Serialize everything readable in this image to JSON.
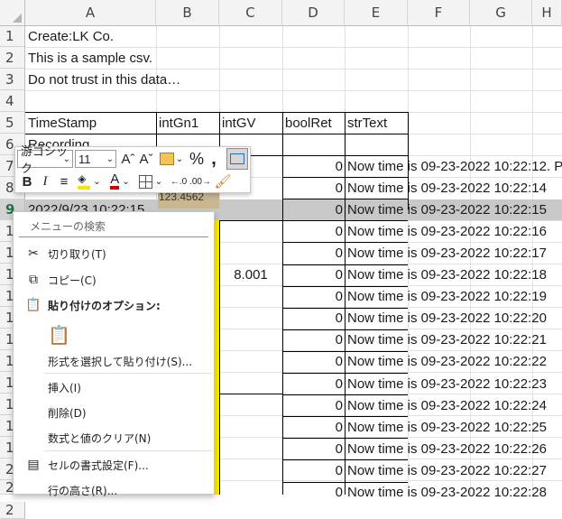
{
  "columns": [
    "A",
    "B",
    "C",
    "D",
    "E",
    "F",
    "G",
    "H"
  ],
  "rows": [
    "1",
    "2",
    "3",
    "4",
    "5",
    "6",
    "7",
    "8",
    "9",
    "1",
    "1",
    "1",
    "1",
    "1",
    "1",
    "1",
    "1",
    "1",
    "1",
    "1",
    "2",
    "2",
    "2"
  ],
  "cells": {
    "a1": "Create:LK Co.",
    "a2": "This is a sample csv.",
    "a3": "Do not trust in this data…",
    "a5": "TimeStamp",
    "b5": "intGn1",
    "c5": "intGV",
    "d5": "boolRet",
    "e5": "strText",
    "a6": "Recording",
    "b8": "123.4562",
    "a9": "2022/9/23 10:22:15",
    "c_merged": "8.001"
  },
  "boolRet": [
    "0",
    "0",
    "0",
    "0",
    "0",
    "0",
    "0",
    "0",
    "0",
    "0",
    "0",
    "0",
    "0",
    "0",
    "0",
    "0"
  ],
  "strText": [
    "Now time is 09-23-2022 10:22:12. P",
    "Now time is 09-23-2022 10:22:14",
    "Now time is 09-23-2022 10:22:15",
    "Now time is 09-23-2022 10:22:16",
    "Now time is 09-23-2022 10:22:17",
    "Now time is 09-23-2022 10:22:18",
    "Now time is 09-23-2022 10:22:19",
    "Now time is 09-23-2022 10:22:20",
    "Now time is 09-23-2022 10:22:21",
    "Now time is 09-23-2022 10:22:22",
    "Now time is 09-23-2022 10:22:23",
    "Now time is 09-23-2022 10:22:24",
    "Now time is 09-23-2022 10:22:25",
    "Now time is 09-23-2022 10:22:26",
    "Now time is 09-23-2022 10:22:27",
    "Now time is 09-23-2022 10:22:28"
  ],
  "toolbar": {
    "font": "游ゴシック",
    "size": "11",
    "bold": "B",
    "italic": "I",
    "percent": "%",
    "comma": "͓",
    "grow": "Aˆ",
    "shrink": "Aˇ"
  },
  "menu": {
    "search": "メニューの検索",
    "cut": "切り取り(T)",
    "copy": "コピー(C)",
    "paste_options": "貼り付けのオプション:",
    "paste_special": "形式を選択して貼り付け(S)...",
    "insert": "挿入(I)",
    "delete": "削除(D)",
    "clear": "数式と値のクリア(N)",
    "format_cells": "セルの書式設定(F)...",
    "row_height": "行の高さ(R)..."
  },
  "colors": {
    "accent": "#217346",
    "yellow": "#ffeb00",
    "font_red": "#d00000",
    "fill_yellow": "#ffe000"
  }
}
